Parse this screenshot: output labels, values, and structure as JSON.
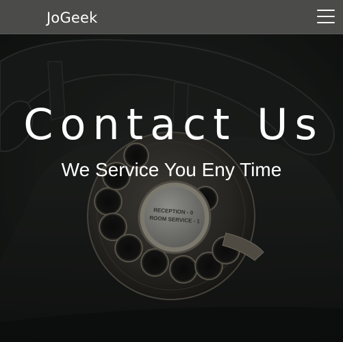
{
  "navbar": {
    "brand": "JoGeek",
    "menu_icon": "hamburger-menu-icon"
  },
  "hero": {
    "title": "Contact Us",
    "subtitle": "We Service You Eny Time",
    "dial_label_line1": "RECEPTION - 0",
    "dial_label_line2": "ROOM SERVICE - 1"
  },
  "colors": {
    "navbar_bg": "#4b4b4a",
    "hero_bg": "#1b1d1c",
    "text": "#ffffff"
  }
}
